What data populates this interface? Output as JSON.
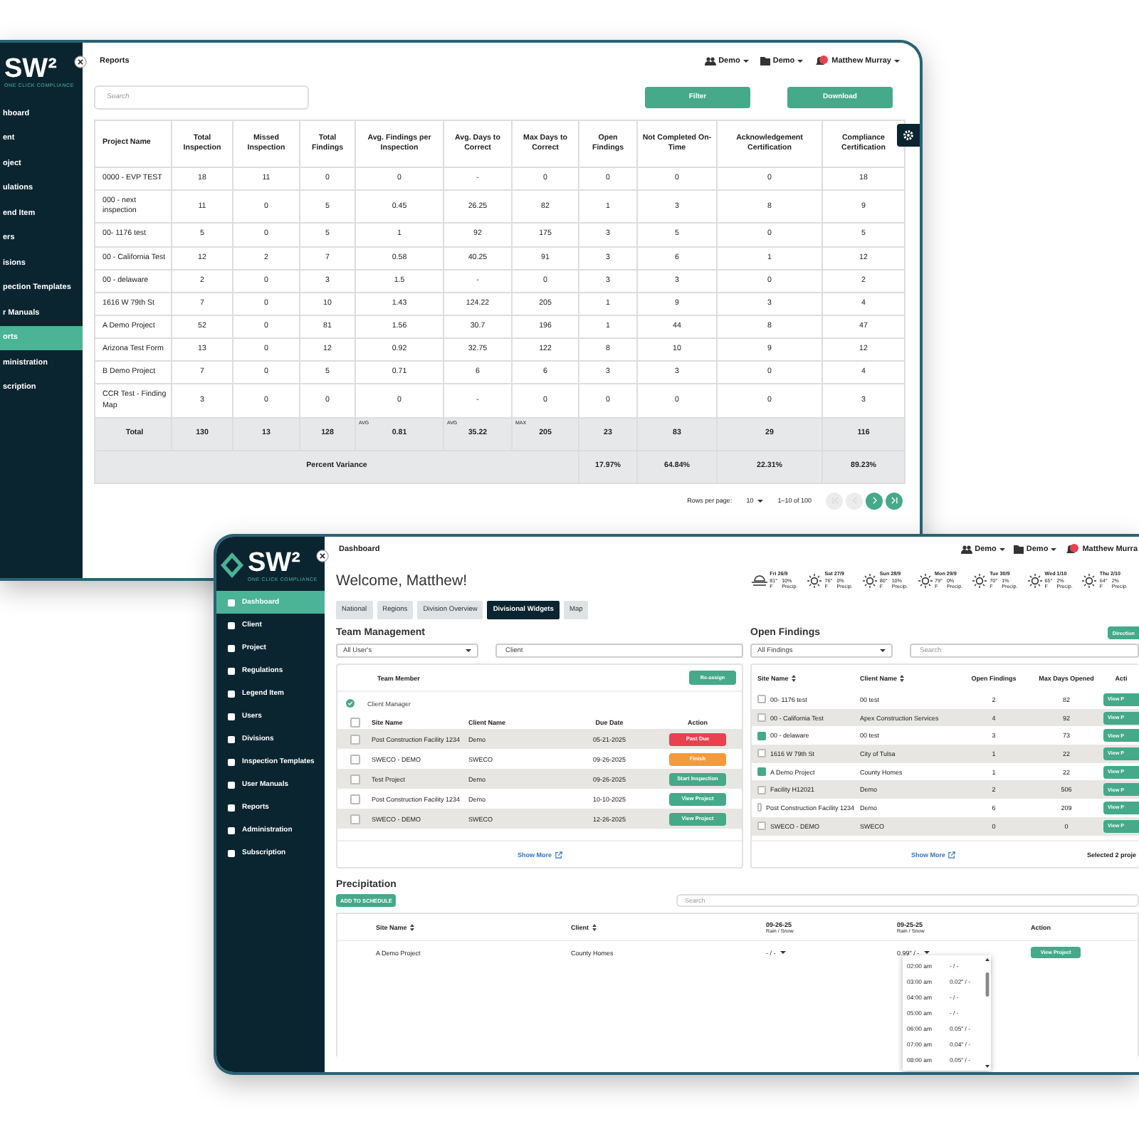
{
  "back_window": {
    "logo": "SW²",
    "tagline": "ONE CLICK COMPLIANCE",
    "sidebar": [
      {
        "label": "hboard",
        "selected": false
      },
      {
        "label": "ent",
        "selected": false
      },
      {
        "label": "oject",
        "selected": false
      },
      {
        "label": "ulations",
        "selected": false
      },
      {
        "label": "end Item",
        "selected": false
      },
      {
        "label": "ers",
        "selected": false
      },
      {
        "label": "isions",
        "selected": false
      },
      {
        "label": "pection Templates",
        "selected": false
      },
      {
        "label": "r Manuals",
        "selected": false
      },
      {
        "label": "orts",
        "selected": true
      },
      {
        "label": "ministration",
        "selected": false
      },
      {
        "label": "scription",
        "selected": false
      }
    ],
    "page_title": "Reports",
    "workspaces": [
      "Demo",
      "Demo"
    ],
    "user": "Matthew Murray",
    "search": {
      "placeholder": "Search"
    },
    "buttons": [
      "Filter",
      "Download"
    ],
    "table": {
      "columns": [
        "Project Name",
        "Total Inspection",
        "Missed Inspection",
        "Total Findings",
        "Avg. Findings per Inspection",
        "Avg. Days to Correct",
        "Max Days to Correct",
        "Open Findings",
        "Not Completed On-Time",
        "Acknowledgement Certification",
        "Compliance Certification"
      ],
      "rows": [
        [
          "0000 - EVP TEST",
          "18",
          "11",
          "0",
          "0",
          "-",
          "0",
          "0",
          "0",
          "0",
          "18"
        ],
        [
          "000 - next inspection",
          "11",
          "0",
          "5",
          "0.45",
          "26.25",
          "82",
          "1",
          "3",
          "8",
          "9"
        ],
        [
          "00- 1176 test",
          "5",
          "0",
          "5",
          "1",
          "92",
          "175",
          "3",
          "5",
          "0",
          "5"
        ],
        [
          "00 - California Test",
          "12",
          "2",
          "7",
          "0.58",
          "40.25",
          "91",
          "3",
          "6",
          "1",
          "12"
        ],
        [
          "00 - delaware",
          "2",
          "0",
          "3",
          "1.5",
          "-",
          "0",
          "3",
          "3",
          "0",
          "2"
        ],
        [
          "1616 W 79th St",
          "7",
          "0",
          "10",
          "1.43",
          "124.22",
          "205",
          "1",
          "9",
          "3",
          "4"
        ],
        [
          "A Demo Project",
          "52",
          "0",
          "81",
          "1.56",
          "30.7",
          "196",
          "1",
          "44",
          "8",
          "47"
        ],
        [
          "Arizona Test Form",
          "13",
          "0",
          "12",
          "0.92",
          "32.75",
          "122",
          "8",
          "10",
          "9",
          "12"
        ],
        [
          "B Demo Project",
          "7",
          "0",
          "5",
          "0.71",
          "6",
          "6",
          "3",
          "3",
          "0",
          "4"
        ],
        [
          "CCR Test - Finding Map",
          "3",
          "0",
          "0",
          "0",
          "-",
          "0",
          "0",
          "0",
          "0",
          "3"
        ]
      ],
      "total": {
        "label": "Total",
        "cells": [
          {
            "value": "130"
          },
          {
            "value": "13"
          },
          {
            "value": "128"
          },
          {
            "tag": "AVG",
            "value": "0.81"
          },
          {
            "tag": "AVG",
            "value": "35.22"
          },
          {
            "tag": "MAX",
            "value": "205"
          },
          {
            "value": "23"
          },
          {
            "value": "83"
          },
          {
            "value": "29"
          },
          {
            "value": "116"
          }
        ]
      },
      "variance": {
        "label": "Percent Variance",
        "cells": [
          "17.97%",
          "64.84%",
          "22.31%",
          "89.23%"
        ]
      }
    },
    "pagination": {
      "rows_label": "Rows per page:",
      "rows_value": "10",
      "range": "1–10 of 100",
      "buttons": [
        {
          "kind": "first",
          "disabled": true
        },
        {
          "kind": "prev",
          "disabled": true
        },
        {
          "kind": "next",
          "disabled": false
        },
        {
          "kind": "last",
          "disabled": false
        }
      ]
    }
  },
  "front_window": {
    "logo": "SW²",
    "tagline": "ONE CLICK COMPLIANCE",
    "sidebar": [
      {
        "label": "Dashboard",
        "selected": true
      },
      {
        "label": "Client",
        "selected": false
      },
      {
        "label": "Project",
        "selected": false
      },
      {
        "label": "Regulations",
        "selected": false
      },
      {
        "label": "Legend Item",
        "selected": false
      },
      {
        "label": "Users",
        "selected": false
      },
      {
        "label": "Divisions",
        "selected": false
      },
      {
        "label": "Inspection Templates",
        "selected": false
      },
      {
        "label": "User Manuals",
        "selected": false
      },
      {
        "label": "Reports",
        "selected": false
      },
      {
        "label": "Administration",
        "selected": false
      },
      {
        "label": "Subscription",
        "selected": false
      }
    ],
    "page_title": "Dashboard",
    "workspaces": [
      "Demo",
      "Demo"
    ],
    "user": "Matthew Murra",
    "welcome": "Welcome, Matthew!",
    "weather": [
      {
        "kind": "cloud",
        "day": "Fri 26/9",
        "temp": "81°",
        "precip": "10%",
        "unit": "F",
        "precip_label": "Precip."
      },
      {
        "kind": "sun",
        "day": "Sat 27/9",
        "temp": "76°",
        "precip": "0%",
        "unit": "F",
        "precip_label": "Precip."
      },
      {
        "kind": "sun",
        "day": "Sun 28/9",
        "temp": "80°",
        "precip": "10%",
        "unit": "F",
        "precip_label": "Precip."
      },
      {
        "kind": "sun",
        "day": "Mon 29/9",
        "temp": "79°",
        "precip": "0%",
        "unit": "F",
        "precip_label": "Precip."
      },
      {
        "kind": "sun",
        "day": "Tue 30/9",
        "temp": "70°",
        "precip": "1%",
        "unit": "F",
        "precip_label": "Precip."
      },
      {
        "kind": "sun",
        "day": "Wed 1/10",
        "temp": "65°",
        "precip": "2%",
        "unit": "F",
        "precip_label": "Precip."
      },
      {
        "kind": "sun",
        "day": "Thu 2/10",
        "temp": "64°",
        "precip": "2%",
        "unit": "F",
        "precip_label": "Precip."
      }
    ],
    "tabs": [
      {
        "label": "National",
        "selected": false
      },
      {
        "label": "Regions",
        "selected": false
      },
      {
        "label": "Division Overview",
        "selected": false
      },
      {
        "label": "Divisional Widgets",
        "selected": true
      },
      {
        "label": "Map",
        "selected": false
      }
    ],
    "team_management": {
      "title": "Team Management",
      "select_all_checked": false,
      "select": "All User's",
      "client_field": "Client",
      "header": "Team Member",
      "button": "Re-assign",
      "group": "Client Manager",
      "columns": [
        "Site Name",
        "Client Name",
        "Due Date",
        "Action"
      ],
      "rows": [
        {
          "site": "Post Construction Facility 1234",
          "client": "Demo",
          "due": "05-21-2025",
          "action": "Past Due",
          "color": "#e8414f",
          "checked": false
        },
        {
          "site": "SWECO - DEMO",
          "client": "SWECO",
          "due": "09-26-2025",
          "action": "Finish",
          "color": "#f59a3a",
          "checked": false
        },
        {
          "site": "Test Project",
          "client": "Demo",
          "due": "09-26-2025",
          "action": "Start Inspection",
          "color": "#45a98a",
          "checked": false
        },
        {
          "site": "Post Construction Facility 1234",
          "client": "Demo",
          "due": "10-10-2025",
          "action": "View Project",
          "color": "#45a98a",
          "checked": false
        },
        {
          "site": "SWECO - DEMO",
          "client": "SWECO",
          "due": "12-26-2025",
          "action": "View Project",
          "color": "#45a98a",
          "checked": false
        }
      ],
      "show_more": "Show More"
    },
    "open_findings": {
      "title": "Open Findings",
      "button": "Direction",
      "select": "All Findings",
      "search": {
        "placeholder": "Search"
      },
      "columns": [
        {
          "label": "Site Name",
          "sortable": true
        },
        {
          "label": "Client Name",
          "sortable": true
        },
        {
          "label": "Open Findings",
          "sortable": false
        },
        {
          "label": "Max Days Opened",
          "sortable": false
        },
        {
          "label": "Acti",
          "sortable": false
        }
      ],
      "rows": [
        {
          "site": "00- 1176 test",
          "client": "00 test",
          "open": "2",
          "max_days": "82",
          "action": "View P",
          "checked": false
        },
        {
          "site": "00 - California Test",
          "client": "Apex Construction Services",
          "open": "4",
          "max_days": "92",
          "action": "View P",
          "checked": false
        },
        {
          "site": "00 - delaware",
          "client": "00 test",
          "open": "3",
          "max_days": "73",
          "action": "View P",
          "checked": true
        },
        {
          "site": "1616 W 79th St",
          "client": "City of Tulsa",
          "open": "1",
          "max_days": "22",
          "action": "View P",
          "checked": false
        },
        {
          "site": "A Demo Project",
          "client": "County Homes",
          "open": "1",
          "max_days": "22",
          "action": "View P",
          "checked": true
        },
        {
          "site": "Facility H12021",
          "client": "Demo",
          "open": "2",
          "max_days": "506",
          "action": "View P",
          "checked": false
        },
        {
          "site": "Post Construction Facility 1234",
          "client": "Demo",
          "open": "6",
          "max_days": "209",
          "action": "View P",
          "checked": false
        },
        {
          "site": "SWECO - DEMO",
          "client": "SWECO",
          "open": "0",
          "max_days": "0",
          "action": "View P",
          "checked": false
        }
      ],
      "show_more": "Show More",
      "selected_note": "Selected 2 proje"
    },
    "precipitation": {
      "title": "Precipitation",
      "button": "ADD TO SCHEDULE",
      "search": {
        "placeholder": "Search"
      },
      "columns": [
        {
          "label": "Site Name",
          "sortable": true
        },
        {
          "label": "Client",
          "sortable": true
        },
        {
          "label": "09-26-25",
          "sub": "Rain / Snow",
          "sortable": false
        },
        {
          "label": "09-25-25",
          "sub": "Rain / Snow",
          "sortable": false
        },
        {
          "label": "Action",
          "sortable": false
        }
      ],
      "row": {
        "site": "A Demo Project",
        "client": "County Homes",
        "day1": "- / -",
        "day2": "0.99\" / -",
        "action": "View Project"
      },
      "dropdown": [
        {
          "time": "02:00 am",
          "value": "- / -"
        },
        {
          "time": "03:00 am",
          "value": "0.02\" / -"
        },
        {
          "time": "04:00 am",
          "value": "- / -"
        },
        {
          "time": "05:00 am",
          "value": "- / -"
        },
        {
          "time": "06:00 am",
          "value": "0.05\" / -"
        },
        {
          "time": "07:00 am",
          "value": "0.04\" / -"
        },
        {
          "time": "08:00 am",
          "value": "0.05\" / -"
        }
      ]
    }
  }
}
